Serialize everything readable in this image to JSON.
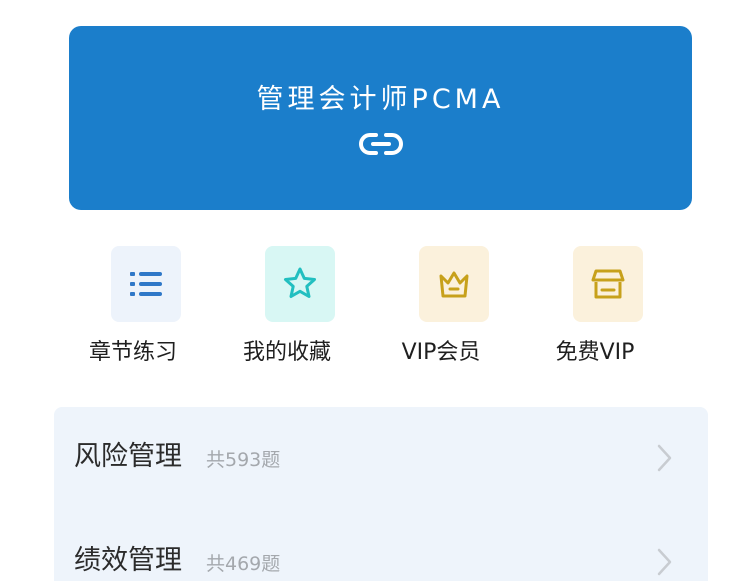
{
  "banner": {
    "title": "管理会计师PCMA",
    "link_icon": "link-icon"
  },
  "quick_actions": [
    {
      "label": "章节练习",
      "icon": "list-icon",
      "bg": "#edf3fb",
      "fg": "#2f78c8"
    },
    {
      "label": "我的收藏",
      "icon": "star-icon",
      "bg": "#d8f7f4",
      "fg": "#22bfc0"
    },
    {
      "label": "VIP会员",
      "icon": "crown-icon",
      "bg": "#fbf1dc",
      "fg": "#c7a11b"
    },
    {
      "label": "免费VIP",
      "icon": "shop-icon",
      "bg": "#fbf1dc",
      "fg": "#c7a11b"
    }
  ],
  "chapter_list": [
    {
      "title": "风险管理",
      "count": "共593题"
    },
    {
      "title": "绩效管理",
      "count": "共469题"
    }
  ],
  "colors": {
    "primary": "#1b7ecb",
    "list_bg": "#eef4fb",
    "muted_text": "#a4a8ad",
    "title_text": "#2b2b2b"
  }
}
